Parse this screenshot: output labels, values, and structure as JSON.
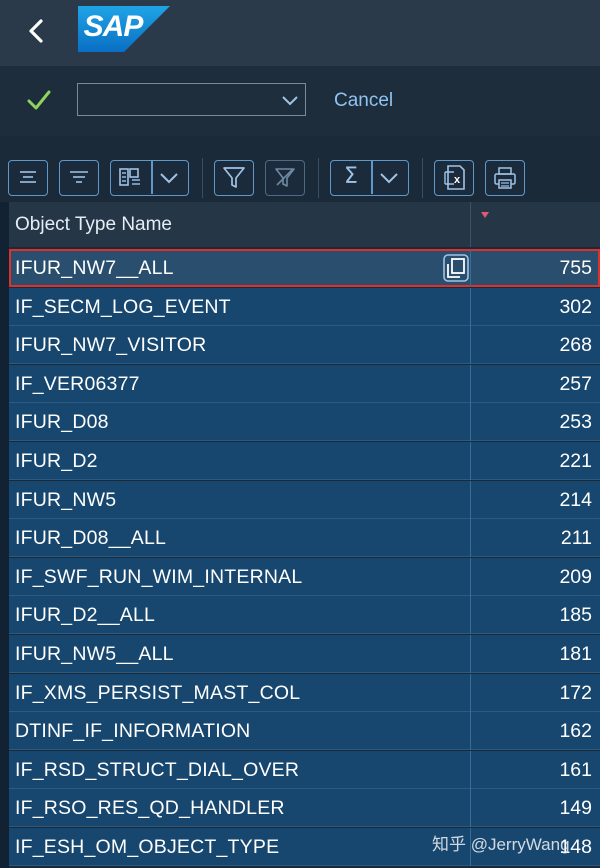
{
  "header": {
    "logo_text": "SAP"
  },
  "actionbar": {
    "dropdown_value": "",
    "cancel_label": "Cancel"
  },
  "toolbar": {
    "buttons": [
      {
        "name": "align-top-button",
        "icon": "align-top-icon"
      },
      {
        "name": "align-middle-button",
        "icon": "align-middle-icon"
      },
      {
        "name": "layout-button",
        "icon": "layout-icon"
      },
      {
        "name": "layout-menu-button",
        "icon": "chevron-down-icon"
      },
      {
        "name": "filter-button",
        "icon": "filter-icon"
      },
      {
        "name": "clear-filter-button",
        "icon": "clear-filter-icon"
      },
      {
        "name": "sum-button",
        "icon": "sigma-icon"
      },
      {
        "name": "sum-menu-button",
        "icon": "chevron-down-icon"
      },
      {
        "name": "export-excel-button",
        "icon": "excel-export-icon"
      },
      {
        "name": "print-button",
        "icon": "print-icon"
      }
    ],
    "sum_symbol": "Σ"
  },
  "table": {
    "columns": [
      "Object Type Name",
      ""
    ],
    "rows": [
      {
        "name": "IFUR_NW7__ALL",
        "count": "755"
      },
      {
        "name": "IF_SECM_LOG_EVENT",
        "count": "302"
      },
      {
        "name": "IFUR_NW7_VISITOR",
        "count": "268"
      },
      {
        "name": "IF_VER06377",
        "count": "257"
      },
      {
        "name": "IFUR_D08",
        "count": "253"
      },
      {
        "name": "IFUR_D2",
        "count": "221"
      },
      {
        "name": "IFUR_NW5",
        "count": "214"
      },
      {
        "name": "IFUR_D08__ALL",
        "count": "211"
      },
      {
        "name": "IF_SWF_RUN_WIM_INTERNAL",
        "count": "209"
      },
      {
        "name": "IFUR_D2__ALL",
        "count": "185"
      },
      {
        "name": "IFUR_NW5__ALL",
        "count": "181"
      },
      {
        "name": "IF_XMS_PERSIST_MAST_COL",
        "count": "172"
      },
      {
        "name": "DTINF_IF_INFORMATION",
        "count": "162"
      },
      {
        "name": "IF_RSD_STRUCT_DIAL_OVER",
        "count": "161"
      },
      {
        "name": "IF_RSO_RES_QD_HANDLER",
        "count": "149"
      },
      {
        "name": "IF_ESH_OM_OBJECT_TYPE",
        "count": "148"
      }
    ]
  },
  "watermark": "知乎 @JerryWang",
  "colors": {
    "accent": "#8fc3f2",
    "selection": "#17476e",
    "highlight_border": "#e0302c",
    "check": "#8ed35d"
  }
}
